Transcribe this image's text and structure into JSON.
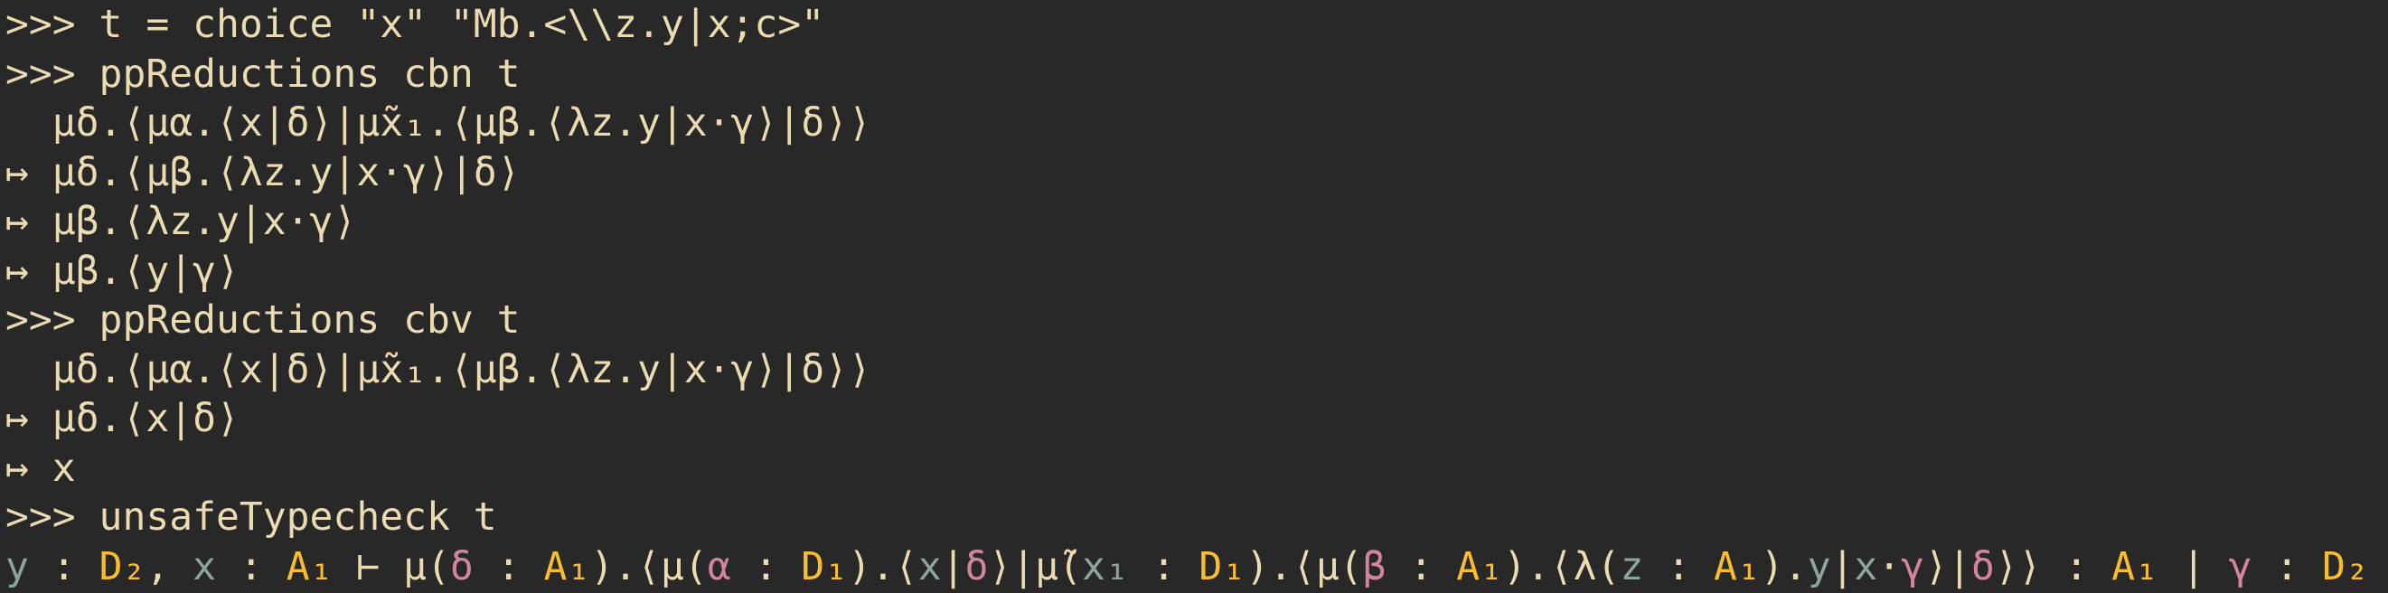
{
  "colors": {
    "background": "#282828",
    "fg": "#ebdbb2",
    "type": "#fabd2f",
    "var": "#8ea59c",
    "covar": "#d3869b"
  },
  "terminal": {
    "lines": [
      {
        "kind": "input",
        "segments": [
          {
            "t": ">>> t = choice \"x\" \"Mb.<\\\\z.y|x;c>\"",
            "c": "fg"
          }
        ]
      },
      {
        "kind": "input",
        "segments": [
          {
            "t": ">>> ppReductions cbn t",
            "c": "fg"
          }
        ]
      },
      {
        "kind": "output",
        "segments": [
          {
            "t": "  μδ.⟨μα.⟨x|δ⟩|μ̃x₁.⟨μβ.⟨λz.y|x·γ⟩|δ⟩⟩",
            "c": "fg"
          }
        ]
      },
      {
        "kind": "output",
        "segments": [
          {
            "t": "↦ μδ.⟨μβ.⟨λz.y|x·γ⟩|δ⟩",
            "c": "fg"
          }
        ]
      },
      {
        "kind": "output",
        "segments": [
          {
            "t": "↦ μβ.⟨λz.y|x·γ⟩",
            "c": "fg"
          }
        ]
      },
      {
        "kind": "output",
        "segments": [
          {
            "t": "↦ μβ.⟨y|γ⟩",
            "c": "fg"
          }
        ]
      },
      {
        "kind": "input",
        "segments": [
          {
            "t": ">>> ppReductions cbv t",
            "c": "fg"
          }
        ]
      },
      {
        "kind": "output",
        "segments": [
          {
            "t": "  μδ.⟨μα.⟨x|δ⟩|μ̃x₁.⟨μβ.⟨λz.y|x·γ⟩|δ⟩⟩",
            "c": "fg"
          }
        ]
      },
      {
        "kind": "output",
        "segments": [
          {
            "t": "↦ μδ.⟨x|δ⟩",
            "c": "fg"
          }
        ]
      },
      {
        "kind": "output",
        "segments": [
          {
            "t": "↦ x",
            "c": "fg"
          }
        ]
      },
      {
        "kind": "input",
        "segments": [
          {
            "t": ">>> unsafeTypecheck t",
            "c": "fg"
          }
        ]
      },
      {
        "kind": "output",
        "segments": [
          {
            "t": "y",
            "c": "var"
          },
          {
            "t": " : ",
            "c": "fg"
          },
          {
            "t": "D₂",
            "c": "type"
          },
          {
            "t": ", ",
            "c": "fg"
          },
          {
            "t": "x",
            "c": "var"
          },
          {
            "t": " : ",
            "c": "fg"
          },
          {
            "t": "A₁",
            "c": "type"
          },
          {
            "t": " ⊢ μ(",
            "c": "fg"
          },
          {
            "t": "δ",
            "c": "covar"
          },
          {
            "t": " : ",
            "c": "fg"
          },
          {
            "t": "A₁",
            "c": "type"
          },
          {
            "t": ").⟨μ(",
            "c": "fg"
          },
          {
            "t": "α",
            "c": "covar"
          },
          {
            "t": " : ",
            "c": "fg"
          },
          {
            "t": "D₁",
            "c": "type"
          },
          {
            "t": ").⟨",
            "c": "fg"
          },
          {
            "t": "x",
            "c": "var"
          },
          {
            "t": "|",
            "c": "fg"
          },
          {
            "t": "δ",
            "c": "covar"
          },
          {
            "t": "⟩|μ̃(",
            "c": "fg"
          },
          {
            "t": "x₁",
            "c": "var"
          },
          {
            "t": " : ",
            "c": "fg"
          },
          {
            "t": "D₁",
            "c": "type"
          },
          {
            "t": ").⟨μ(",
            "c": "fg"
          },
          {
            "t": "β",
            "c": "covar"
          },
          {
            "t": " : ",
            "c": "fg"
          },
          {
            "t": "A₁",
            "c": "type"
          },
          {
            "t": ").⟨λ(",
            "c": "fg"
          },
          {
            "t": "z",
            "c": "var"
          },
          {
            "t": " : ",
            "c": "fg"
          },
          {
            "t": "A₁",
            "c": "type"
          },
          {
            "t": ").",
            "c": "fg"
          },
          {
            "t": "y",
            "c": "var"
          },
          {
            "t": "|",
            "c": "fg"
          },
          {
            "t": "x",
            "c": "var"
          },
          {
            "t": "·",
            "c": "fg"
          },
          {
            "t": "γ",
            "c": "covar"
          },
          {
            "t": "⟩|",
            "c": "fg"
          },
          {
            "t": "δ",
            "c": "covar"
          },
          {
            "t": "⟩⟩ : ",
            "c": "fg"
          },
          {
            "t": "A₁",
            "c": "type"
          },
          {
            "t": " | ",
            "c": "fg"
          },
          {
            "t": "γ",
            "c": "covar"
          },
          {
            "t": " : ",
            "c": "fg"
          },
          {
            "t": "D₂",
            "c": "type"
          }
        ]
      }
    ]
  }
}
